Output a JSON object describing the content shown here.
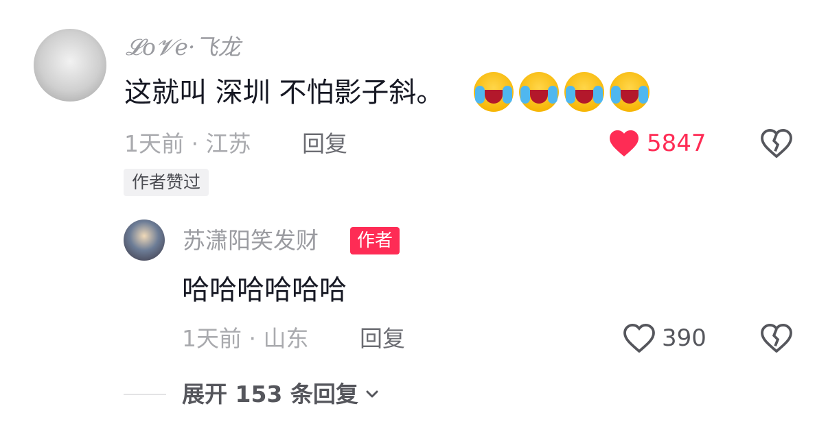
{
  "main_comment": {
    "username": "𝓛o𝓥e·飞龙",
    "text": "这就叫 深圳 不怕影子斜。",
    "emojis": [
      "laugh-cry-emoji",
      "laugh-cry-emoji",
      "laugh-cry-emoji",
      "laugh-cry-emoji"
    ],
    "meta": "1天前 · 江苏",
    "reply_label": "回复",
    "like_count": "5847",
    "liked": true,
    "author_liked_badge": "作者赞过",
    "colors": {
      "like": "#fe2c55"
    }
  },
  "reply_comment": {
    "username": "苏潇阳笑发财",
    "author_tag": "作者",
    "text": "哈哈哈哈哈哈",
    "meta": "1天前 · 山东",
    "reply_label": "回复",
    "like_count": "390",
    "liked": false
  },
  "expand": {
    "label": "展开 153 条回复",
    "icon": "chevron-down-icon"
  }
}
